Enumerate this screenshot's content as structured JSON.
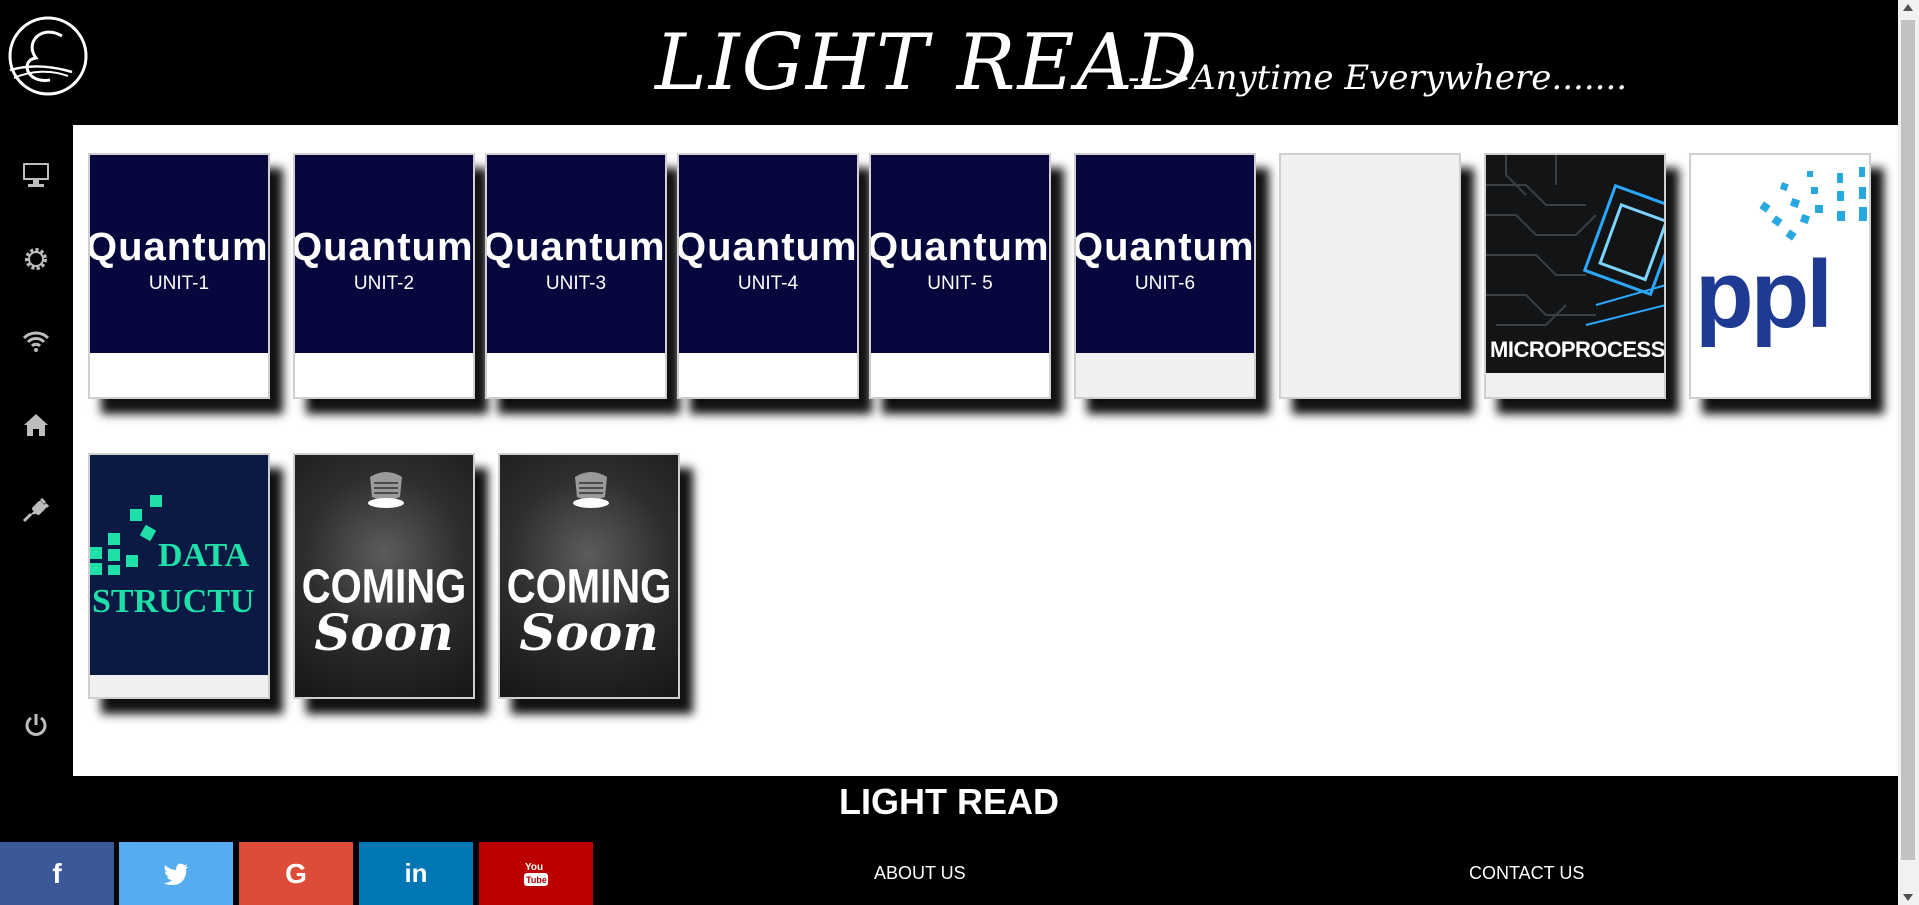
{
  "header": {
    "title": "LIGHT READ",
    "tagline": "--->Anytime Everywhere.......",
    "logo_icon": "e-logo-icon"
  },
  "sidebar": {
    "items": [
      {
        "icon": "monitor-icon"
      },
      {
        "icon": "gear-icon"
      },
      {
        "icon": "wifi-icon"
      },
      {
        "icon": "home-icon"
      },
      {
        "icon": "plug-icon"
      },
      {
        "icon": "power-icon"
      }
    ]
  },
  "cards": {
    "q1": {
      "brand": "Quantum",
      "unit": "UNIT-1"
    },
    "q2": {
      "brand": "Quantum",
      "unit": "UNIT-2"
    },
    "q3": {
      "brand": "Quantum",
      "unit": "UNIT-3"
    },
    "q4": {
      "brand": "Quantum",
      "unit": "UNIT-4"
    },
    "q5": {
      "brand": "Quantum",
      "unit": "UNIT- 5"
    },
    "q6": {
      "brand": "Quantum",
      "unit": "UNIT-6"
    },
    "micro": {
      "label": "MICROPROCESSOR"
    },
    "ppl": {
      "label": "ppl"
    },
    "ds": {
      "line1": "DATA",
      "line2": "STRUCTU"
    },
    "soon1": {
      "line1": "COMING",
      "line2": "Soon"
    },
    "soon2": {
      "line1": "COMING",
      "line2": "Soon"
    }
  },
  "footer": {
    "title": "LIGHT READ",
    "about": "ABOUT US",
    "contact": "CONTACT US",
    "social": [
      {
        "icon": "facebook-icon",
        "glyph": "f",
        "color": "#3b5998"
      },
      {
        "icon": "twitter-icon",
        "glyph": "",
        "color": "#55acee"
      },
      {
        "icon": "google-icon",
        "glyph": "G",
        "color": "#dd4b39"
      },
      {
        "icon": "linkedin-icon",
        "glyph": "in",
        "color": "#0077b5"
      },
      {
        "icon": "youtube-icon",
        "glyph": "",
        "color": "#bb0000"
      }
    ]
  },
  "colors": {
    "background": "#000000",
    "quantum_bg": "#05073d",
    "content_bg": "#ffffff"
  }
}
